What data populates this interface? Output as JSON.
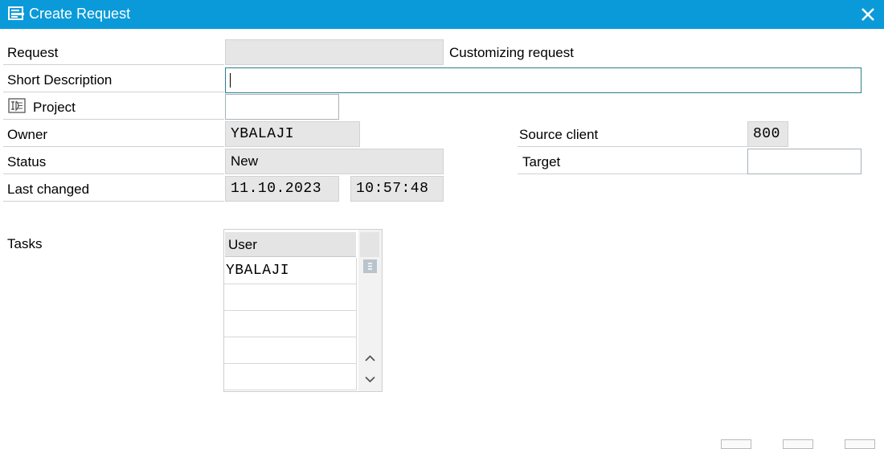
{
  "window": {
    "title": "Create Request"
  },
  "form": {
    "request": {
      "label": "Request",
      "value": "",
      "type_text": "Customizing request"
    },
    "short_description": {
      "label": "Short Description",
      "value": ""
    },
    "project": {
      "label": "Project",
      "value": ""
    },
    "owner": {
      "label": "Owner",
      "value": "YBALAJI"
    },
    "status": {
      "label": "Status",
      "value": "New"
    },
    "last_changed": {
      "label": "Last changed",
      "date": "11.10.2023",
      "time": "10:57:48"
    },
    "source_client": {
      "label": "Source client",
      "value": "800"
    },
    "target": {
      "label": "Target",
      "value": ""
    }
  },
  "tasks": {
    "label": "Tasks",
    "column_header": "User",
    "rows": [
      "YBALAJI",
      "",
      "",
      "",
      ""
    ]
  },
  "icons": {
    "window_icon": "request-window-icon",
    "close": "close-icon",
    "project": "project-icon",
    "scroll_menu": "column-menu-icon",
    "scroll_up": "chevron-up-icon",
    "scroll_down": "chevron-down-icon"
  },
  "colors": {
    "titlebar": "#0a9ad9",
    "readonly_field": "#e6e6e6"
  }
}
